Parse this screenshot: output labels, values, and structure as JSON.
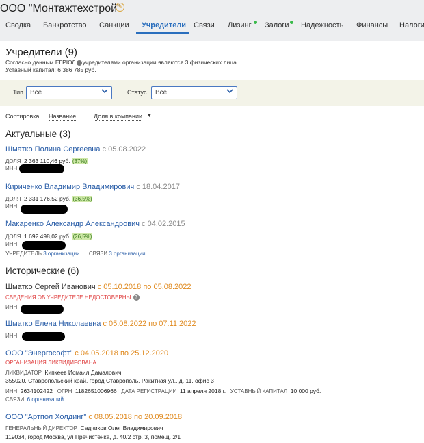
{
  "header": {
    "company_name": "ООО \"Монтажтехстрой\"",
    "tabs": [
      "Сводка",
      "Банкротство",
      "Санкции",
      "Учредители",
      "Связи",
      "Лизинг",
      "Залоги",
      "Надежность",
      "Финансы",
      "Налоги"
    ],
    "active_tab": "Учредители",
    "colors": {
      "accent": "#2a6ebd",
      "dot": "#3aba4b"
    }
  },
  "founders": {
    "title": "Учредители (9)",
    "note_prefix": "Согласно данным ЕГРЮЛ",
    "note_suffix": "учредителями организации являются 3 физических лица.",
    "capital": "Уставный капитал: 6 386 785 руб."
  },
  "filters": {
    "type_label": "Тип",
    "type_value": "Все",
    "status_label": "Статус",
    "status_value": "Все"
  },
  "sort": {
    "label": "Сортировка",
    "by_name": "Название",
    "by_share": "Доля в компании"
  },
  "actual": {
    "title": "Актуальные (3)",
    "people": [
      {
        "name": "Шматко Полина Сергеевна",
        "since": "с 05.08.2022",
        "share_label": "ДОЛЯ",
        "share": "2 363 110,46 руб.",
        "pct": "(37%)",
        "inn_label": "ИНН"
      },
      {
        "name": "Кириченко Владимир Владимирович",
        "since": "с 18.04.2017",
        "share_label": "ДОЛЯ",
        "share": "2 331 176,52 руб.",
        "pct": "(36,5%)",
        "inn_label": "ИНН"
      },
      {
        "name": "Макаренко Александр Александрович",
        "since": "с 04.02.2015",
        "share_label": "ДОЛЯ",
        "share": "1 692 498,02 руб.",
        "pct": "(26,5%)",
        "inn_label": "ИНН",
        "founder_label": "УЧРЕДИТЕЛЬ",
        "founder_value": "3 организации",
        "links_label": "СВЯЗИ",
        "links_value": "3 организации"
      }
    ]
  },
  "historical": {
    "title": "Исторические (6)",
    "p1": {
      "name": "Шматко Сергей Иванович",
      "period": "с 05.10.2018 по 05.08.2022",
      "warning": "СВЕДЕНИЯ ОБ УЧРЕДИТЕЛЕ НЕДОСТОВЕРНЫ",
      "inn_label": "ИНН"
    },
    "p2": {
      "name": "Шматко Елена Николаевна",
      "period": "с 05.08.2022 по 07.11.2022",
      "inn_label": "ИНН"
    },
    "o1": {
      "name": "ООО \"Энергософт\"",
      "period": "с 04.05.2018 по 25.12.2020",
      "status": "ОРГАНИЗАЦИЯ ЛИКВИДИРОВАНА",
      "role_label": "ЛИКВИДАТОР",
      "role_person": "Кипкеев Исмаил Дамалович",
      "address": "355020, Ставропольский край, город Ставрополь, Ракитная ул., д. 11, офис 3",
      "inn_label": "ИНН",
      "inn": "2634102422",
      "ogrn_label": "ОГРН",
      "ogrn": "1182651006966",
      "reg_label": "ДАТА РЕГИСТРАЦИИ",
      "reg": "11 апреля 2018 г.",
      "cap_label": "УСТАВНЫЙ КАПИТАЛ",
      "cap": "10 000 руб.",
      "links_label": "СВЯЗИ",
      "links_value": "6 организаций"
    },
    "o2": {
      "name": "ООО \"Артпол Холдинг\"",
      "period": "с 08.05.2018 по 20.09.2018",
      "role_label": "ГЕНЕРАЛЬНЫЙ ДИРЕКТОР",
      "role_person": "Садчиков Олег Владимирович",
      "address": "119034, город Москва, ул Пречистенка, д. 40/2 стр. 3, помещ. 2/1"
    }
  }
}
